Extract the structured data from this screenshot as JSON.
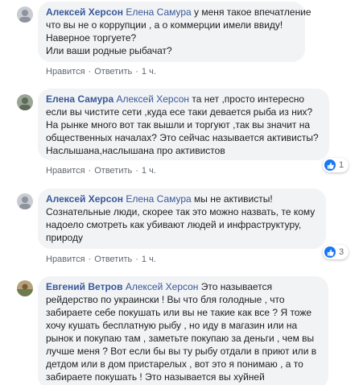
{
  "colors": {
    "author_link": "#385898",
    "bubble_bg": "#f2f3f5",
    "meta_text": "#606770",
    "like_blue": "#1877f2"
  },
  "comments": [
    {
      "author": "Алексей Херсон",
      "mention": "Елена Самура",
      "first_line_rest": " у меня такое впечатление",
      "lines": [
        "что вы не о коррупции , а о коммерции имели ввиду!",
        "Наверное торгуете?",
        "Или ваши родные рыбачат?"
      ],
      "like_label": "Нравится",
      "reply_label": "Ответить",
      "time": "1 ч."
    },
    {
      "author": "Елена Самура",
      "mention": "Алексей Херсон",
      "first_line_rest": " та нет ,просто интересно",
      "lines": [
        "если вы чистите сети ,куда есе таки девается рыба из них?",
        "На рынке много вот так вышли и торгуют ,так вы значит на",
        "общественных началах? Это сейчас называется активисты?",
        "Наслышана,наслышана про активистов"
      ],
      "like_label": "Нравится",
      "reply_label": "Ответить",
      "time": "1 ч.",
      "reaction_count": "1"
    },
    {
      "author": "Алексей Херсон",
      "mention": "Елена Самура",
      "first_line_rest": " мы не активисты!",
      "lines": [
        "Сознательные люди, скорее так это можно назвать, те кому",
        "надоело смотреть как убивают людей и инфраструктуру,",
        "природу"
      ],
      "like_label": "Нравится",
      "reply_label": "Ответить",
      "time": "1 ч.",
      "reaction_count": "3"
    },
    {
      "author": "Евгений Ветров",
      "mention": "Алексей Херсон",
      "first_line_rest": " Это называется",
      "lines": [
        "рейдерство по украински ! Вы что бля голодные , что",
        "забираете себе покушать или вы не такие как все ? Я тоже",
        "хочу кушать бесплатную рыбу , но иду в магазин или на",
        "рынок и покупаю там , заметьте покупаю за деньги , чем вы",
        "лучше меня ? Вот если бы вы ту рыбу отдали в приют или в",
        "детдом или в дом пристарелых , вот это я понимаю , а то",
        "забираете покушать ! Это называется вы хуйней"
      ]
    }
  ]
}
